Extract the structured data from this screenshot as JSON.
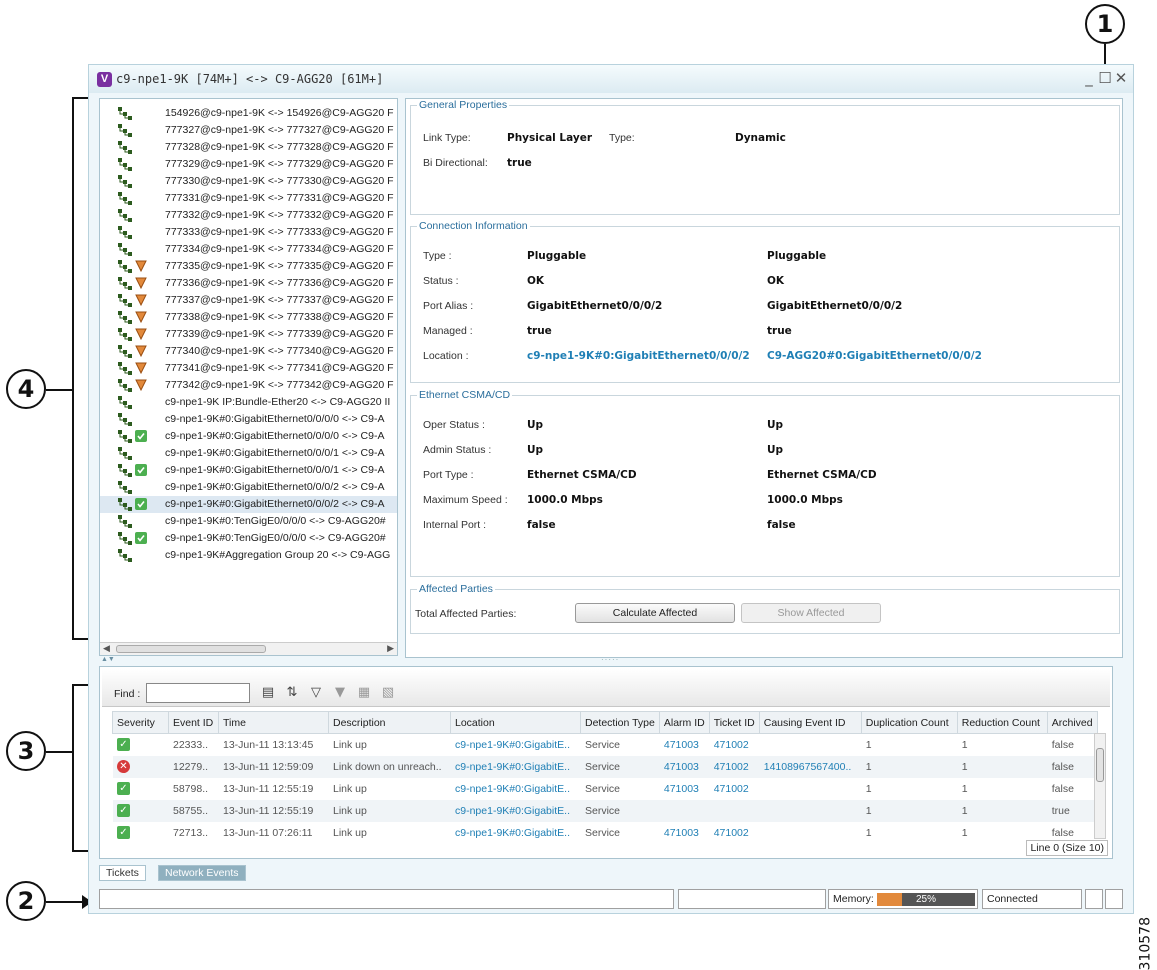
{
  "window": {
    "title_icon": "V",
    "title": "c9-npe1-9K [74M+] <-> C9-AGG20 [61M+]",
    "controls": [
      "_",
      "☐",
      "✕"
    ]
  },
  "callouts": {
    "c1": "1",
    "c2": "2",
    "c3": "3",
    "c4": "4"
  },
  "figure_id": "310578",
  "tree": {
    "items": [
      {
        "label": "154926@c9-npe1-9K <-> 154926@C9-AGG20 F",
        "badge": "none"
      },
      {
        "label": "777327@c9-npe1-9K <-> 777327@C9-AGG20 F",
        "badge": "none"
      },
      {
        "label": "777328@c9-npe1-9K <-> 777328@C9-AGG20 F",
        "badge": "none"
      },
      {
        "label": "777329@c9-npe1-9K <-> 777329@C9-AGG20 F",
        "badge": "none"
      },
      {
        "label": "777330@c9-npe1-9K <-> 777330@C9-AGG20 F",
        "badge": "none"
      },
      {
        "label": "777331@c9-npe1-9K <-> 777331@C9-AGG20 F",
        "badge": "none"
      },
      {
        "label": "777332@c9-npe1-9K <-> 777332@C9-AGG20 F",
        "badge": "none"
      },
      {
        "label": "777333@c9-npe1-9K <-> 777333@C9-AGG20 F",
        "badge": "none"
      },
      {
        "label": "777334@c9-npe1-9K <-> 777334@C9-AGG20 F",
        "badge": "none"
      },
      {
        "label": "777335@c9-npe1-9K <-> 777335@C9-AGG20 F",
        "badge": "warning"
      },
      {
        "label": "777336@c9-npe1-9K <-> 777336@C9-AGG20 F",
        "badge": "warning"
      },
      {
        "label": "777337@c9-npe1-9K <-> 777337@C9-AGG20 F",
        "badge": "warning"
      },
      {
        "label": "777338@c9-npe1-9K <-> 777338@C9-AGG20 F",
        "badge": "warning"
      },
      {
        "label": "777339@c9-npe1-9K <-> 777339@C9-AGG20 F",
        "badge": "warning"
      },
      {
        "label": "777340@c9-npe1-9K <-> 777340@C9-AGG20 F",
        "badge": "warning"
      },
      {
        "label": "777341@c9-npe1-9K <-> 777341@C9-AGG20 F",
        "badge": "warning"
      },
      {
        "label": "777342@c9-npe1-9K <-> 777342@C9-AGG20 F",
        "badge": "warning"
      },
      {
        "label": "c9-npe1-9K IP:Bundle-Ether20 <-> C9-AGG20 II",
        "badge": "none"
      },
      {
        "label": "c9-npe1-9K#0:GigabitEthernet0/0/0/0 <-> C9-A",
        "badge": "none"
      },
      {
        "label": "c9-npe1-9K#0:GigabitEthernet0/0/0/0 <-> C9-A",
        "badge": "ok"
      },
      {
        "label": "c9-npe1-9K#0:GigabitEthernet0/0/0/1 <-> C9-A",
        "badge": "none"
      },
      {
        "label": "c9-npe1-9K#0:GigabitEthernet0/0/0/1 <-> C9-A",
        "badge": "ok"
      },
      {
        "label": "c9-npe1-9K#0:GigabitEthernet0/0/0/2 <-> C9-A",
        "badge": "none"
      },
      {
        "label": "c9-npe1-9K#0:GigabitEthernet0/0/0/2 <-> C9-A",
        "badge": "ok",
        "selected": true
      },
      {
        "label": "c9-npe1-9K#0:TenGigE0/0/0/0 <-> C9-AGG20#",
        "badge": "none"
      },
      {
        "label": "c9-npe1-9K#0:TenGigE0/0/0/0 <-> C9-AGG20#",
        "badge": "ok"
      },
      {
        "label": "c9-npe1-9K#Aggregation Group 20 <-> C9-AGG",
        "badge": "none"
      }
    ]
  },
  "general": {
    "title": "General Properties",
    "link_type_label": "Link Type:",
    "link_type_value": "Physical Layer",
    "type_label": "Type:",
    "type_value": "Dynamic",
    "bidir_label": "Bi Directional:",
    "bidir_value": "true"
  },
  "connection": {
    "title": "Connection Information",
    "rows": [
      {
        "label": "Type :",
        "a": "Pluggable",
        "b": "Pluggable",
        "link": false
      },
      {
        "label": "Status :",
        "a": "OK",
        "b": "OK",
        "link": false
      },
      {
        "label": "Port Alias :",
        "a": "GigabitEthernet0/0/0/2",
        "b": "GigabitEthernet0/0/0/2",
        "link": false
      },
      {
        "label": "Managed :",
        "a": "true",
        "b": "true",
        "link": false
      },
      {
        "label": "Location :",
        "a": "c9-npe1-9K#0:GigabitEthernet0/0/0/2",
        "b": "C9-AGG20#0:GigabitEthernet0/0/0/2",
        "link": true
      }
    ]
  },
  "ethernet": {
    "title": "Ethernet CSMA/CD",
    "rows": [
      {
        "label": "Oper Status :",
        "a": "Up",
        "b": "Up"
      },
      {
        "label": "Admin Status :",
        "a": "Up",
        "b": "Up"
      },
      {
        "label": "Port Type :",
        "a": "Ethernet CSMA/CD",
        "b": "Ethernet CSMA/CD"
      },
      {
        "label": "Maximum Speed :",
        "a": "1000.0 Mbps",
        "b": "1000.0 Mbps"
      },
      {
        "label": "Internal Port :",
        "a": "false",
        "b": "false"
      }
    ]
  },
  "affected": {
    "title": "Affected Parties",
    "total_label": "Total Affected Parties:",
    "calculate_button": "Calculate Affected",
    "show_button": "Show Affected"
  },
  "events": {
    "find_label": "Find :",
    "find_value": "",
    "columns": [
      "Severity",
      "Event ID",
      "Time",
      "Description",
      "Location",
      "Detection Type",
      "Alarm ID",
      "Ticket ID",
      "Causing Event ID",
      "Duplication Count",
      "Reduction Count",
      "Archived"
    ],
    "rows": [
      {
        "severity": "ok",
        "event_id": "22333..",
        "time": "13-Jun-11 13:13:45",
        "description": "Link up",
        "location": "c9-npe1-9K#0:GigabitE..",
        "detection": "Service",
        "alarm": "471003",
        "ticket": "471002",
        "causing": "",
        "dup": "1",
        "red": "1",
        "archived": "false"
      },
      {
        "severity": "critical",
        "event_id": "12279..",
        "time": "13-Jun-11 12:59:09",
        "description": "Link down on unreach..",
        "location": "c9-npe1-9K#0:GigabitE..",
        "detection": "Service",
        "alarm": "471003",
        "ticket": "471002",
        "causing": "14108967567400..",
        "dup": "1",
        "red": "1",
        "archived": "false"
      },
      {
        "severity": "ok",
        "event_id": "58798..",
        "time": "13-Jun-11 12:55:19",
        "description": "Link up",
        "location": "c9-npe1-9K#0:GigabitE..",
        "detection": "Service",
        "alarm": "471003",
        "ticket": "471002",
        "causing": "",
        "dup": "1",
        "red": "1",
        "archived": "false"
      },
      {
        "severity": "ok",
        "event_id": "58755..",
        "time": "13-Jun-11 12:55:19",
        "description": "Link up",
        "location": "c9-npe1-9K#0:GigabitE..",
        "detection": "Service",
        "alarm": "",
        "ticket": "",
        "causing": "",
        "dup": "1",
        "red": "1",
        "archived": "true"
      },
      {
        "severity": "ok",
        "event_id": "72713..",
        "time": "13-Jun-11 07:26:11",
        "description": "Link up",
        "location": "c9-npe1-9K#0:GigabitE..",
        "detection": "Service",
        "alarm": "471003",
        "ticket": "471002",
        "causing": "",
        "dup": "1",
        "red": "1",
        "archived": "false"
      }
    ],
    "line_info": "Line 0 (Size 10)"
  },
  "tabs": {
    "tickets": "Tickets",
    "network_events": "Network Events",
    "active": "network_events"
  },
  "status": {
    "memory_label": "Memory:",
    "memory_percent": 25,
    "memory_text": "25%",
    "connection": "Connected"
  },
  "colors": {
    "accent": "#1f7fb5",
    "warning": "#e2893b",
    "ok": "#4caf50",
    "critical": "#d63a3a"
  }
}
